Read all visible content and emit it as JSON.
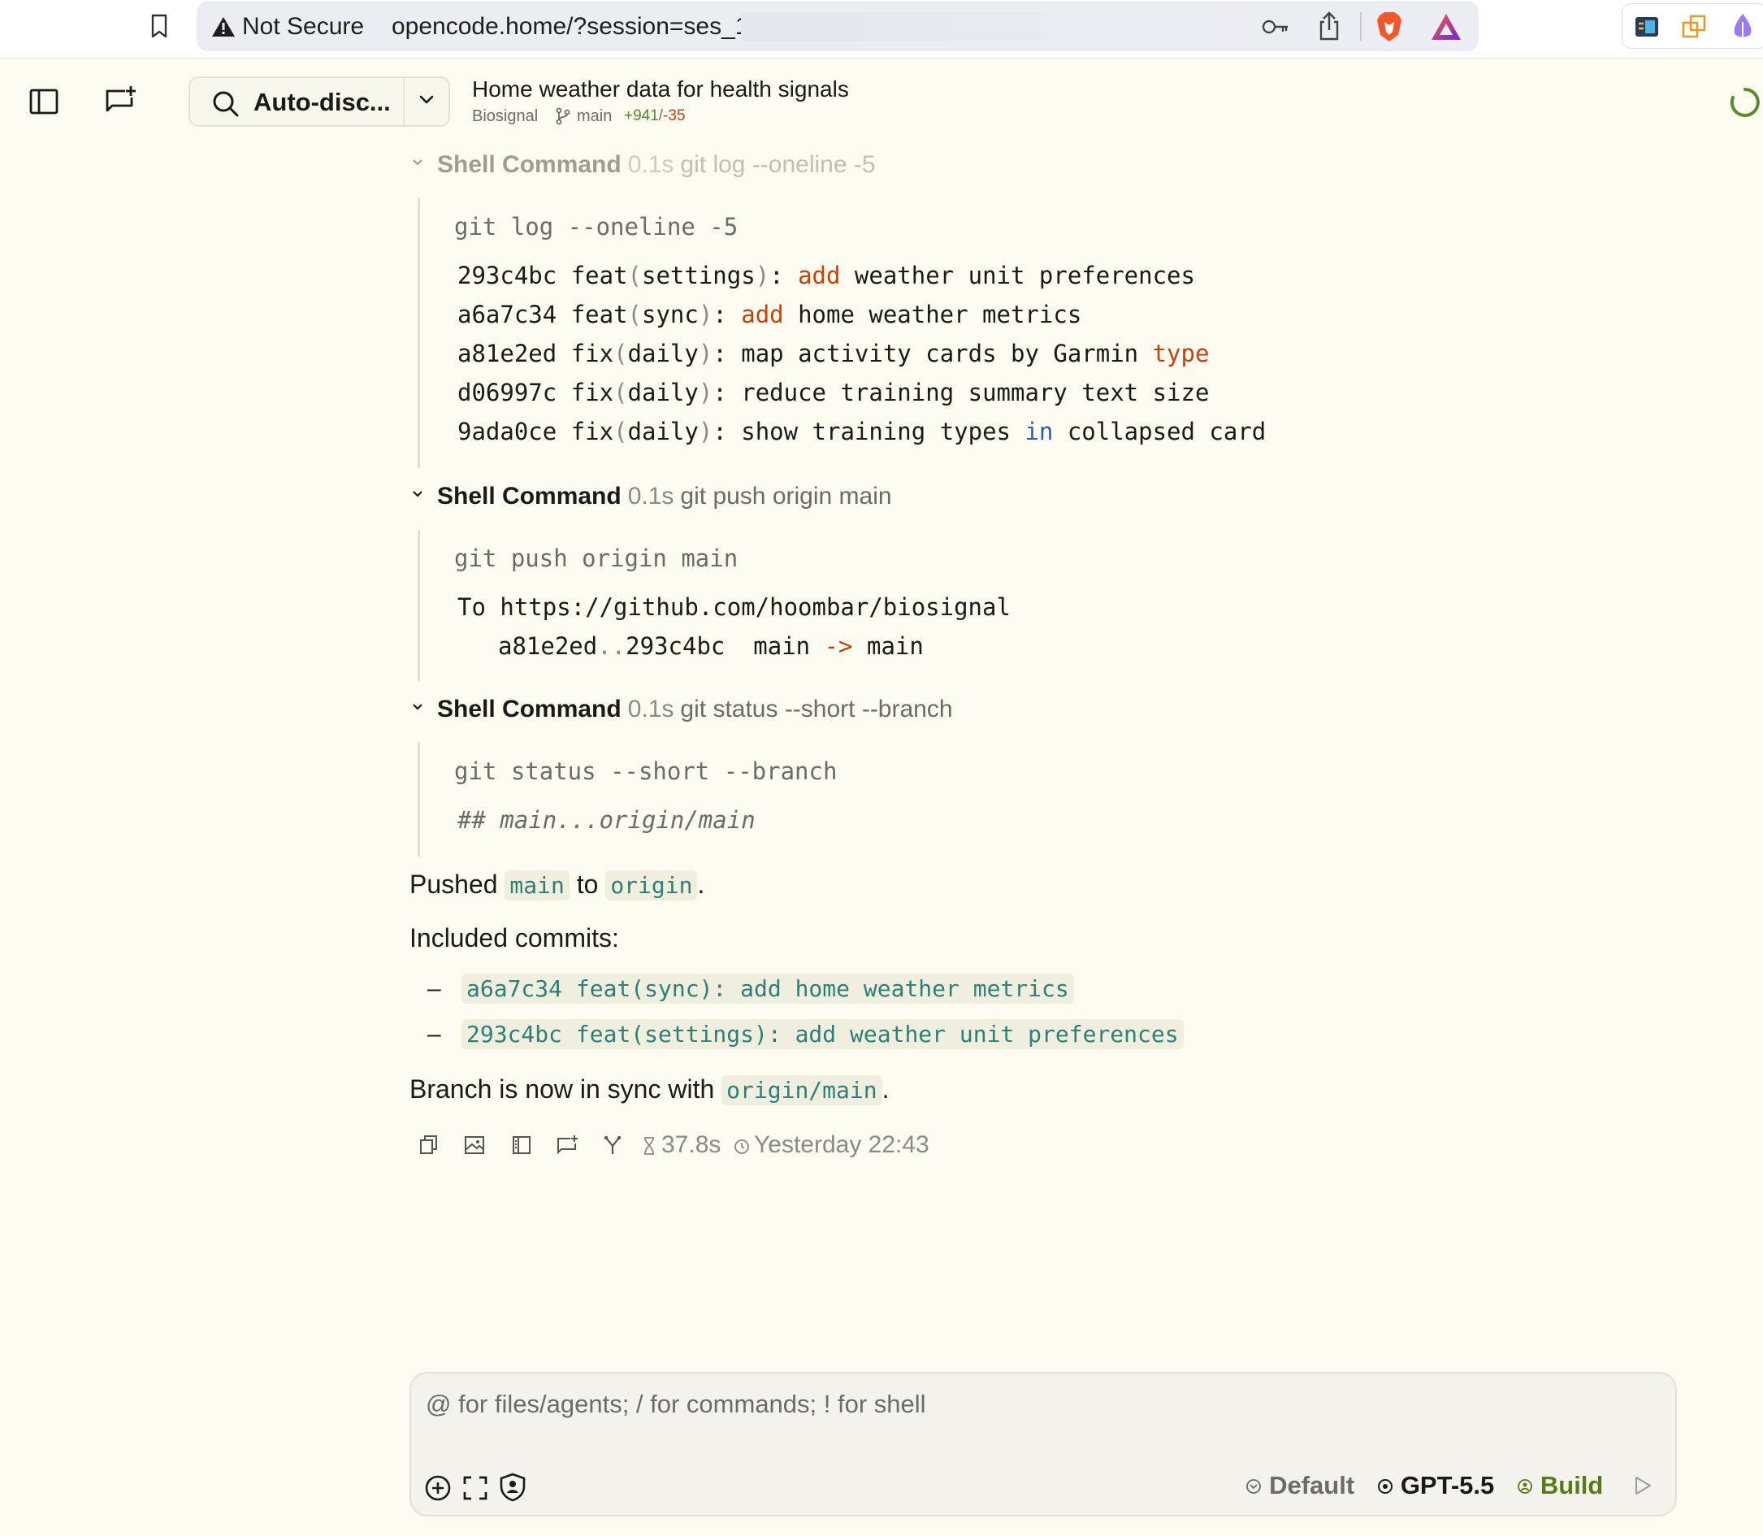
{
  "browser": {
    "security_warning": "Not Secure",
    "url": "opencode.home/?session=ses_1"
  },
  "header": {
    "agent_label": "Auto-disc...",
    "session_title": "Home weather data for health signals",
    "project": "Biosignal",
    "branch": "main",
    "diff_added": "+941",
    "diff_separator": "/",
    "diff_removed": "-35"
  },
  "shell_blocks": [
    {
      "label": "Shell Command",
      "duration": "0.1s",
      "command": "git log --oneline -5",
      "prompt_line": "git log --oneline -5",
      "output": [
        {
          "hash": "293c4bc",
          "kind": "feat",
          "scope": "settings",
          "w1": "add",
          "rest": " weather unit preferences"
        },
        {
          "hash": "a6a7c34",
          "kind": "feat",
          "scope": "sync",
          "w1": "add",
          "rest": " home weather metrics"
        },
        {
          "hash": "a81e2ed",
          "kind": "fix",
          "scope": "daily",
          "pre": " map activity cards by Garmin ",
          "w1": "type"
        },
        {
          "hash": "d06997c",
          "kind": "fix",
          "scope": "daily",
          "pre": " reduce training summary text size"
        },
        {
          "hash": "9ada0ce",
          "kind": "fix",
          "scope": "daily",
          "pre": " show training types ",
          "w1": "in",
          "rest": " collapsed card"
        }
      ]
    },
    {
      "label": "Shell Command",
      "duration": "0.1s",
      "command": "git push origin main",
      "prompt_line": "git push origin main",
      "output": {
        "line1": "To https://github.com/hoombar/biosignal",
        "from_hash": "a81e2ed",
        "range_sep": "..",
        "to_hash": "293c4bc",
        "src_branch": "main",
        "arrow": "->",
        "dst_branch": "main"
      }
    },
    {
      "label": "Shell Command",
      "duration": "0.1s",
      "command": "git status --short --branch",
      "prompt_line": "git status --short --branch",
      "output": "## main...origin/main"
    }
  ],
  "message": {
    "pushed_prefix": "Pushed ",
    "pushed_branch": "main",
    "pushed_mid": " to ",
    "pushed_remote": "origin",
    "pushed_suffix": ".",
    "included": "Included commits:",
    "bullet": "–",
    "commits": [
      "a6a7c34 feat(sync): add home weather metrics",
      "293c4bc feat(settings): add weather unit preferences"
    ],
    "sync_prefix": "Branch is now in sync with ",
    "sync_ref": "origin/main",
    "sync_suffix": ".",
    "duration": "37.8s",
    "timestamp": "Yesterday 22:43"
  },
  "composer": {
    "placeholder": "@ for files/agents; / for commands; ! for shell",
    "permission": "Default",
    "model": "GPT-5.5",
    "mode": "Build"
  },
  "colors": {
    "background": "#fdfbf0",
    "keyword_orange": "#c2410c",
    "keyword_blue": "#2b5fb8",
    "inline_code_teal": "#2e7f79",
    "mode_green": "#5a7a1a",
    "diff_added_green": "#4c8b2b"
  },
  "icons": {
    "bookmark": "bookmark-icon",
    "warning": "warning-icon",
    "key": "key-icon",
    "share": "share-icon",
    "brave": "brave-icon",
    "triangle": "triangle-icon",
    "sidebar": "sidebar-toggle-icon",
    "new_session": "new-session-icon",
    "search": "search-icon",
    "chevron": "chevron-down-icon",
    "branch": "git-branch-icon",
    "spinner": "spinner-icon",
    "copy": "copy-icon",
    "image": "image-icon",
    "panel": "panel-icon",
    "fork": "fork-icon",
    "merge": "merge-icon",
    "hourglass": "hourglass-icon",
    "clock": "clock-icon",
    "add": "add-circle-icon",
    "expand": "expand-icon",
    "shield": "shield-user-icon",
    "send": "send-icon"
  }
}
